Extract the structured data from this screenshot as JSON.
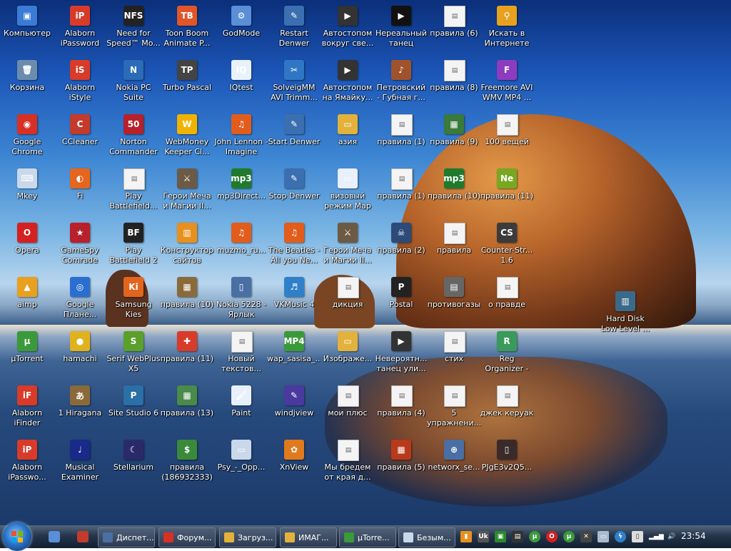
{
  "icons": [
    {
      "label": "Компьютер",
      "c": "#3a7bd5",
      "g": "▣"
    },
    {
      "label": "Alaborn iPassword",
      "c": "#d83b2a",
      "g": "iP"
    },
    {
      "label": "Need for Speed™ Mo...",
      "c": "#222",
      "g": "NFS"
    },
    {
      "label": "Toon Boom Animate P...",
      "c": "#e0562a",
      "g": "TB"
    },
    {
      "label": "GodMode",
      "c": "#5a8fd8",
      "g": "⚙"
    },
    {
      "label": "Restart Denwer",
      "c": "#3c6fb0",
      "g": "✎"
    },
    {
      "label": "Автостопом вокруг све...",
      "c": "#333",
      "g": "▶"
    },
    {
      "label": "Нереальный танец япон...",
      "c": "#111",
      "g": "▶"
    },
    {
      "label": "правила (6)",
      "c": "#f2f2f2",
      "g": "▤"
    },
    {
      "label": "Искать в Интернете",
      "c": "#e6a21e",
      "g": "⚲"
    },
    {
      "label": "Корзина",
      "c": "#6c8cae",
      "g": "🗑"
    },
    {
      "label": "Alaborn iStyle",
      "c": "#d83b2a",
      "g": "iS"
    },
    {
      "label": "Nokia PC Suite",
      "c": "#2b6bb8",
      "g": "N"
    },
    {
      "label": "Turbo Pascal",
      "c": "#444",
      "g": "TP"
    },
    {
      "label": "IQtest",
      "c": "#e8f2fb",
      "g": "IQ"
    },
    {
      "label": "SolveigMM AVI Trimm...",
      "c": "#2f77c4",
      "g": "✂"
    },
    {
      "label": "Автостопом на Ямайку...",
      "c": "#333",
      "g": "▶"
    },
    {
      "label": "Петровский - Губная г...",
      "c": "#a0522d",
      "g": "♪"
    },
    {
      "label": "правила (8)",
      "c": "#f2f2f2",
      "g": "▤"
    },
    {
      "label": "Freemore AVI WMV MP4 ...",
      "c": "#8d3cc0",
      "g": "F"
    },
    {
      "label": "Google Chrome",
      "c": "#d93025",
      "g": "◉"
    },
    {
      "label": "CCleaner",
      "c": "#c23b2c",
      "g": "C"
    },
    {
      "label": "Norton Commander",
      "c": "#b8202a",
      "g": "50"
    },
    {
      "label": "WebMoney Keeper Cl...",
      "c": "#f0b400",
      "g": "W"
    },
    {
      "label": "John Lennon - Imagine",
      "c": "#e25c1c",
      "g": "♫"
    },
    {
      "label": "Start Denwer",
      "c": "#3c6fb0",
      "g": "✎"
    },
    {
      "label": "азия",
      "c": "#e3b23c",
      "g": "▭"
    },
    {
      "label": "правила (1)",
      "c": "#f2f2f2",
      "g": "▤"
    },
    {
      "label": "правила (9)",
      "c": "#3a7a3a",
      "g": "▦"
    },
    {
      "label": "100 вещей",
      "c": "#f2f2f2",
      "g": "▤"
    },
    {
      "label": "Mkey",
      "c": "#c9d8ea",
      "g": "⌨"
    },
    {
      "label": "Fi",
      "c": "#e5661e",
      "g": "◐"
    },
    {
      "label": "Play Battlefield...",
      "c": "#f2f2f2",
      "g": "▤"
    },
    {
      "label": "Герои Меча и Магии II...",
      "c": "#6c5a44",
      "g": "⚔"
    },
    {
      "label": "mp3Direct...",
      "c": "#1f7a2c",
      "g": "mp3"
    },
    {
      "label": "Stop Denwer",
      "c": "#3c6fb0",
      "g": "✎"
    },
    {
      "label": "визовый режим Map",
      "c": "#e8f0fb",
      "g": "▭"
    },
    {
      "label": "правила (1)",
      "c": "#f2f2f2",
      "g": "▤"
    },
    {
      "label": "правила (10)",
      "c": "#1f7a2c",
      "g": "mp3"
    },
    {
      "label": "правила (11)",
      "c": "#78a820",
      "g": "Ne"
    },
    {
      "label": "Opera",
      "c": "#d42020",
      "g": "O"
    },
    {
      "label": "GameSpy Comrade",
      "c": "#b8202a",
      "g": "★"
    },
    {
      "label": "Play Battlefield 2",
      "c": "#222",
      "g": "BF"
    },
    {
      "label": "Конструктор сайтов",
      "c": "#e8901e",
      "g": "▥"
    },
    {
      "label": "muzmo_ru...",
      "c": "#e25c1c",
      "g": "♫"
    },
    {
      "label": "The Beatles - All you Ne...",
      "c": "#e25c1c",
      "g": "♫"
    },
    {
      "label": "Герои Меча и Магии II...",
      "c": "#6c5a44",
      "g": "⚔"
    },
    {
      "label": "правила (2)",
      "c": "#2c4a7a",
      "g": "☠"
    },
    {
      "label": "правила",
      "c": "#f2f2f2",
      "g": "▤"
    },
    {
      "label": "Counter-Str... 1.6",
      "c": "#3b3b3b",
      "g": "CS"
    },
    {
      "label": "aimp",
      "c": "#e8a01e",
      "g": "▲"
    },
    {
      "label": "Google Плане...",
      "c": "#2a6fd0",
      "g": "◎"
    },
    {
      "label": "Samsung Kies",
      "c": "#e2651d",
      "g": "Ki"
    },
    {
      "label": "правила (10)",
      "c": "#8a6a3a",
      "g": "▦"
    },
    {
      "label": "Nokia 5228 - Ярлык",
      "c": "#4a6fa5",
      "g": "▯"
    },
    {
      "label": "VKMusic 4",
      "c": "#2f80c8",
      "g": "♬"
    },
    {
      "label": "дикция",
      "c": "#f2f2f2",
      "g": "▤"
    },
    {
      "label": "Postal",
      "c": "#222",
      "g": "P"
    },
    {
      "label": "противогазы",
      "c": "#666",
      "g": "▤"
    },
    {
      "label": "о правде",
      "c": "#f2f2f2",
      "g": "▤"
    },
    {
      "label": "µTorrent",
      "c": "#3a9a3a",
      "g": "µ"
    },
    {
      "label": "hamachi",
      "c": "#e0b21e",
      "g": "●"
    },
    {
      "label": "Serif WebPlus X5",
      "c": "#5aa02a",
      "g": "S"
    },
    {
      "label": "правила (11)",
      "c": "#d83b2a",
      "g": "✚"
    },
    {
      "label": "Новый текстов...",
      "c": "#f2f2f2",
      "g": "▤"
    },
    {
      "label": "wap_sasisa_...",
      "c": "#3a9a3a",
      "g": "MP4"
    },
    {
      "label": "Изображе...",
      "c": "#e3b23c",
      "g": "▭"
    },
    {
      "label": "Невероятн... танец ули...",
      "c": "#333",
      "g": "▶"
    },
    {
      "label": "стих",
      "c": "#f2f2f2",
      "g": "▤"
    },
    {
      "label": "Reg Organizer -",
      "c": "#3a9a5a",
      "g": "R"
    },
    {
      "label": "Alaborn iFinder",
      "c": "#d83b2a",
      "g": "iF"
    },
    {
      "label": "1 Hiragana",
      "c": "#8a6a3a",
      "g": "あ"
    },
    {
      "label": "Site Studio 6",
      "c": "#2a6fa8",
      "g": "P"
    },
    {
      "label": "правила (13)",
      "c": "#4a8a4a",
      "g": "▦"
    },
    {
      "label": "Paint",
      "c": "#e8f0fb",
      "g": "🖌"
    },
    {
      "label": "windjview",
      "c": "#4a3aa0",
      "g": "✎"
    },
    {
      "label": "мои плюс",
      "c": "#f2f2f2",
      "g": "▤"
    },
    {
      "label": "правила (4)",
      "c": "#f2f2f2",
      "g": "▤"
    },
    {
      "label": "5 упражнени...",
      "c": "#f2f2f2",
      "g": "▤"
    },
    {
      "label": "джек керуак",
      "c": "#f2f2f2",
      "g": "▤"
    },
    {
      "label": "Alaborn iPasswo...",
      "c": "#d83b2a",
      "g": "iP"
    },
    {
      "label": "Musical Examiner",
      "c": "#1a2a8a",
      "g": "♩"
    },
    {
      "label": "Stellarium",
      "c": "#2a2a6a",
      "g": "☾"
    },
    {
      "label": "правила (186932333)",
      "c": "#3a8a3a",
      "g": "$"
    },
    {
      "label": "Psy_-_Opp...",
      "c": "#c9d8ea",
      "g": "▭"
    },
    {
      "label": "XnView",
      "c": "#e07a1e",
      "g": "✿"
    },
    {
      "label": "Мы бредем от края д...",
      "c": "#f2f2f2",
      "g": "▤"
    },
    {
      "label": "правила (5)",
      "c": "#b83a1a",
      "g": "▦"
    },
    {
      "label": "networx_se...",
      "c": "#4a6fa5",
      "g": "⊕"
    },
    {
      "label": "PJgE3v2Q5...",
      "c": "#3a2a2a",
      "g": "▯"
    }
  ],
  "extra_icon": {
    "label": "Hard Disk Low Level ...",
    "c": "#3a6a8a",
    "g": "▥"
  },
  "taskbar": {
    "tasks": [
      {
        "label": "Диспет...",
        "c": "#4a6fa5"
      },
      {
        "label": "Форум...",
        "c": "#d93025"
      },
      {
        "label": "Загруз...",
        "c": "#e3b23c"
      },
      {
        "label": "ИМАГ...",
        "c": "#e3b23c"
      },
      {
        "label": "µTorre...",
        "c": "#3a9a3a"
      },
      {
        "label": "Безым...",
        "c": "#c9d8ea"
      }
    ],
    "clock": "23:54"
  }
}
